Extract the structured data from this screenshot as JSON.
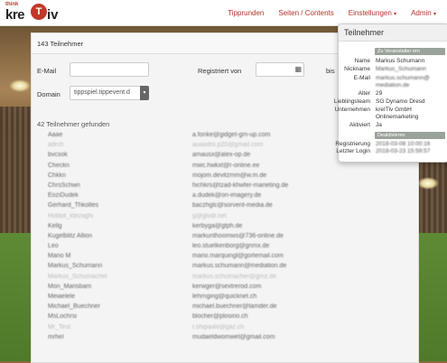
{
  "app": {
    "logo_small": "think",
    "logo_main_left": "kre",
    "logo_ball": "T",
    "logo_main_right": "iv"
  },
  "nav": {
    "items": [
      {
        "label": "Tipprunden"
      },
      {
        "label": "Seiten / Contents"
      },
      {
        "label": "Einstellungen",
        "caret": "▾"
      },
      {
        "label": "Admin",
        "caret": "▾"
      }
    ]
  },
  "panel": {
    "title": "143 Teilnehmer",
    "email_label": "E-Mail",
    "registered_label": "Registriert von",
    "bis_label": "bis",
    "domain_label": "Domain",
    "domain_value": "tippspiel.tippevent.d",
    "count_text": "42 Teilnehmer gefunden"
  },
  "participants": [
    {
      "name": "Aaae",
      "email": "a.fonke@gidget-gm-up.com"
    },
    {
      "name": "adrch",
      "email": "auaadro.p20@gmail.com",
      "dim": true
    },
    {
      "name": "bvcsok",
      "email": "amausx@alex-op.de"
    },
    {
      "name": "Checkn",
      "email": "mwc.hwkxt@r-online.ee"
    },
    {
      "name": "Chkkn",
      "email": "mojom.devitzmm@w.m.de"
    },
    {
      "name": "ChrsSchwn",
      "email": "hichkrs@tzad-khwfer-marieting.de"
    },
    {
      "name": "EoziDudek",
      "email": "a.dudek@on-imagery.de"
    },
    {
      "name": "Gerhard_Thkoltes",
      "email": "baczhglc@sorvent-media.de"
    },
    {
      "name": "Hobbit_ktezaghi",
      "email": "g@glodr.net",
      "dim": true
    },
    {
      "name": "Kellg",
      "email": "kerbyga@gtph.de"
    },
    {
      "name": "Kugelblitz Allion",
      "email": "markunthoomws@736-online.de"
    },
    {
      "name": "Leo",
      "email": "leo.stuelkenborg@gnmx.de"
    },
    {
      "name": "Mario M",
      "email": "mario.marquingl@gorlemail.com"
    },
    {
      "name": "Markus_Schumann",
      "email": "markus.schumann@mediation.de"
    },
    {
      "name": "Markus_Schumacher",
      "email": "markus.schumacher@gmz.de",
      "dim": true
    },
    {
      "name": "Mon_Marisbam",
      "email": "kerwger@sextrerod.com"
    },
    {
      "name": "Meiaelele",
      "email": "lehrnging@quicknet.ch"
    },
    {
      "name": "Michael_Buechner",
      "email": "michael.buechner@tamder.de"
    },
    {
      "name": "MsLochrsi",
      "email": "blocher@plosirio.ch"
    },
    {
      "name": "Mr_Test",
      "email": "r.ohipaalii@gaz.ch",
      "dim": true
    },
    {
      "name": "mrhel",
      "email": "mudaeldwomwet@gmail.com"
    }
  ],
  "popover": {
    "title": "Teilnehmer",
    "fields": [
      {
        "label": "",
        "value": "Zu Veranstalter ern",
        "type": "button"
      },
      {
        "label": "Name",
        "value": "Markus Schumann",
        "type": "text"
      },
      {
        "label": "Nickname",
        "value": "Markus_Schumann",
        "type": "blur"
      },
      {
        "label": "E-Mail",
        "value": "markus.schumann@",
        "type": "blur"
      },
      {
        "label": "",
        "value": "mediation.de",
        "type": "blur"
      },
      {
        "label": "Alter",
        "value": "29",
        "type": "text"
      },
      {
        "label": "Lieblingsteam",
        "value": "SG Dynamo Dresd",
        "type": "text"
      },
      {
        "label": "Unternehmen",
        "value": "kreITiv GmbH",
        "type": "text"
      },
      {
        "label": "",
        "value": "Onlinemarketing",
        "type": "text"
      },
      {
        "label": "Aktiviert",
        "value": "Ja",
        "type": "text"
      },
      {
        "label": "",
        "value": "Deaktivieren",
        "type": "button"
      },
      {
        "label": "Registrierung",
        "value": "2018-03-08 10:00:16",
        "type": "blur"
      },
      {
        "label": "Letzter Login",
        "value": "2018-03-23 15:59:57",
        "type": "blur"
      }
    ]
  }
}
